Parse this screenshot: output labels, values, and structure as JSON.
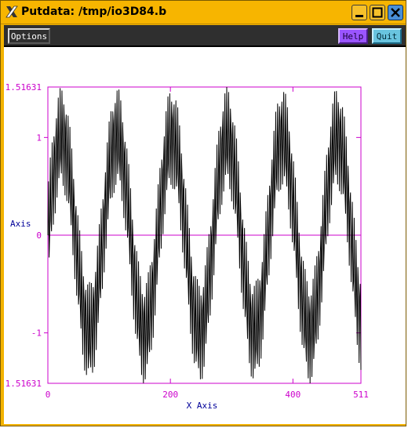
{
  "window": {
    "title": "Putdata: /tmp/io3D84.b",
    "icon": "x11-icon",
    "buttons": [
      "minimize-icon",
      "maximize-icon",
      "close-icon"
    ]
  },
  "menubar": {
    "options_label": "Options",
    "help_label": "Help",
    "quit_label": "Quit"
  },
  "colors": {
    "axis": "#cc00cc",
    "label": "#000099",
    "trace": "#000000",
    "help_bg": "#9a55ff",
    "quit_bg": "#69c4df",
    "title_bar": "#f7b500"
  },
  "chart_data": {
    "type": "line",
    "xlabel": "X Axis",
    "ylabel": "Axis",
    "xlim": [
      0,
      511
    ],
    "ylim": [
      -1.51631,
      1.51631
    ],
    "x_ticks": [
      "0",
      "200",
      "400",
      "511"
    ],
    "y_ticks": [
      "1.51631",
      "1",
      "0",
      "-1",
      "1.51631"
    ],
    "grid": false,
    "zero_line": true,
    "series": [
      {
        "formula": "sin(2*pi*x/90) + 0.5*sin(2*pi*x/3.2)",
        "samples": 512
      }
    ]
  }
}
